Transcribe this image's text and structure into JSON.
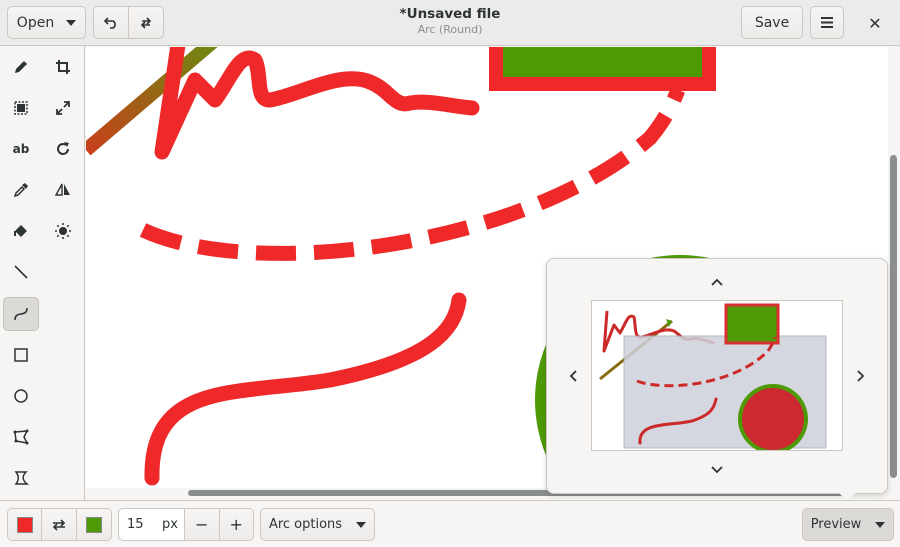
{
  "header": {
    "open_label": "Open",
    "title": "*Unsaved file",
    "subtitle": "Arc (Round)",
    "save_label": "Save",
    "close_glyph": "✕",
    "menu_icon": "hamburger-menu-icon"
  },
  "tools": [
    {
      "name": "pencil",
      "icon": "pencil-icon"
    },
    {
      "name": "crop",
      "icon": "crop-icon"
    },
    {
      "name": "rect-select",
      "icon": "rect-select-icon"
    },
    {
      "name": "scale",
      "icon": "scale-icon"
    },
    {
      "name": "text",
      "icon": "text-icon",
      "glyph": "ab"
    },
    {
      "name": "rotate",
      "icon": "rotate-icon"
    },
    {
      "name": "color-picker",
      "icon": "eyedropper-icon"
    },
    {
      "name": "flip",
      "icon": "flip-icon"
    },
    {
      "name": "paint-bucket",
      "icon": "paint-bucket-icon"
    },
    {
      "name": "filters",
      "icon": "brightness-icon"
    },
    {
      "name": "line",
      "icon": "line-icon"
    },
    {
      "name": "arc",
      "icon": "arc-icon",
      "active": true
    },
    {
      "name": "rectangle",
      "icon": "rectangle-icon"
    },
    {
      "name": "circle",
      "icon": "circle-icon"
    },
    {
      "name": "polygon",
      "icon": "polygon-icon"
    },
    {
      "name": "free-shape",
      "icon": "free-shape-icon"
    }
  ],
  "colors": {
    "main": "#ef2929",
    "secondary": "#4e9a06",
    "accent_red": "#ef2929",
    "accent_green": "#4e9a06"
  },
  "bottombar": {
    "size_value": "15",
    "size_unit": "px",
    "minus_label": "−",
    "plus_label": "+",
    "options_label": "Arc options",
    "preview_label": "Preview"
  },
  "preview": {
    "up_icon": "chevron-up-icon",
    "down_icon": "chevron-down-icon",
    "left_icon": "chevron-left-icon",
    "right_icon": "chevron-right-icon"
  }
}
